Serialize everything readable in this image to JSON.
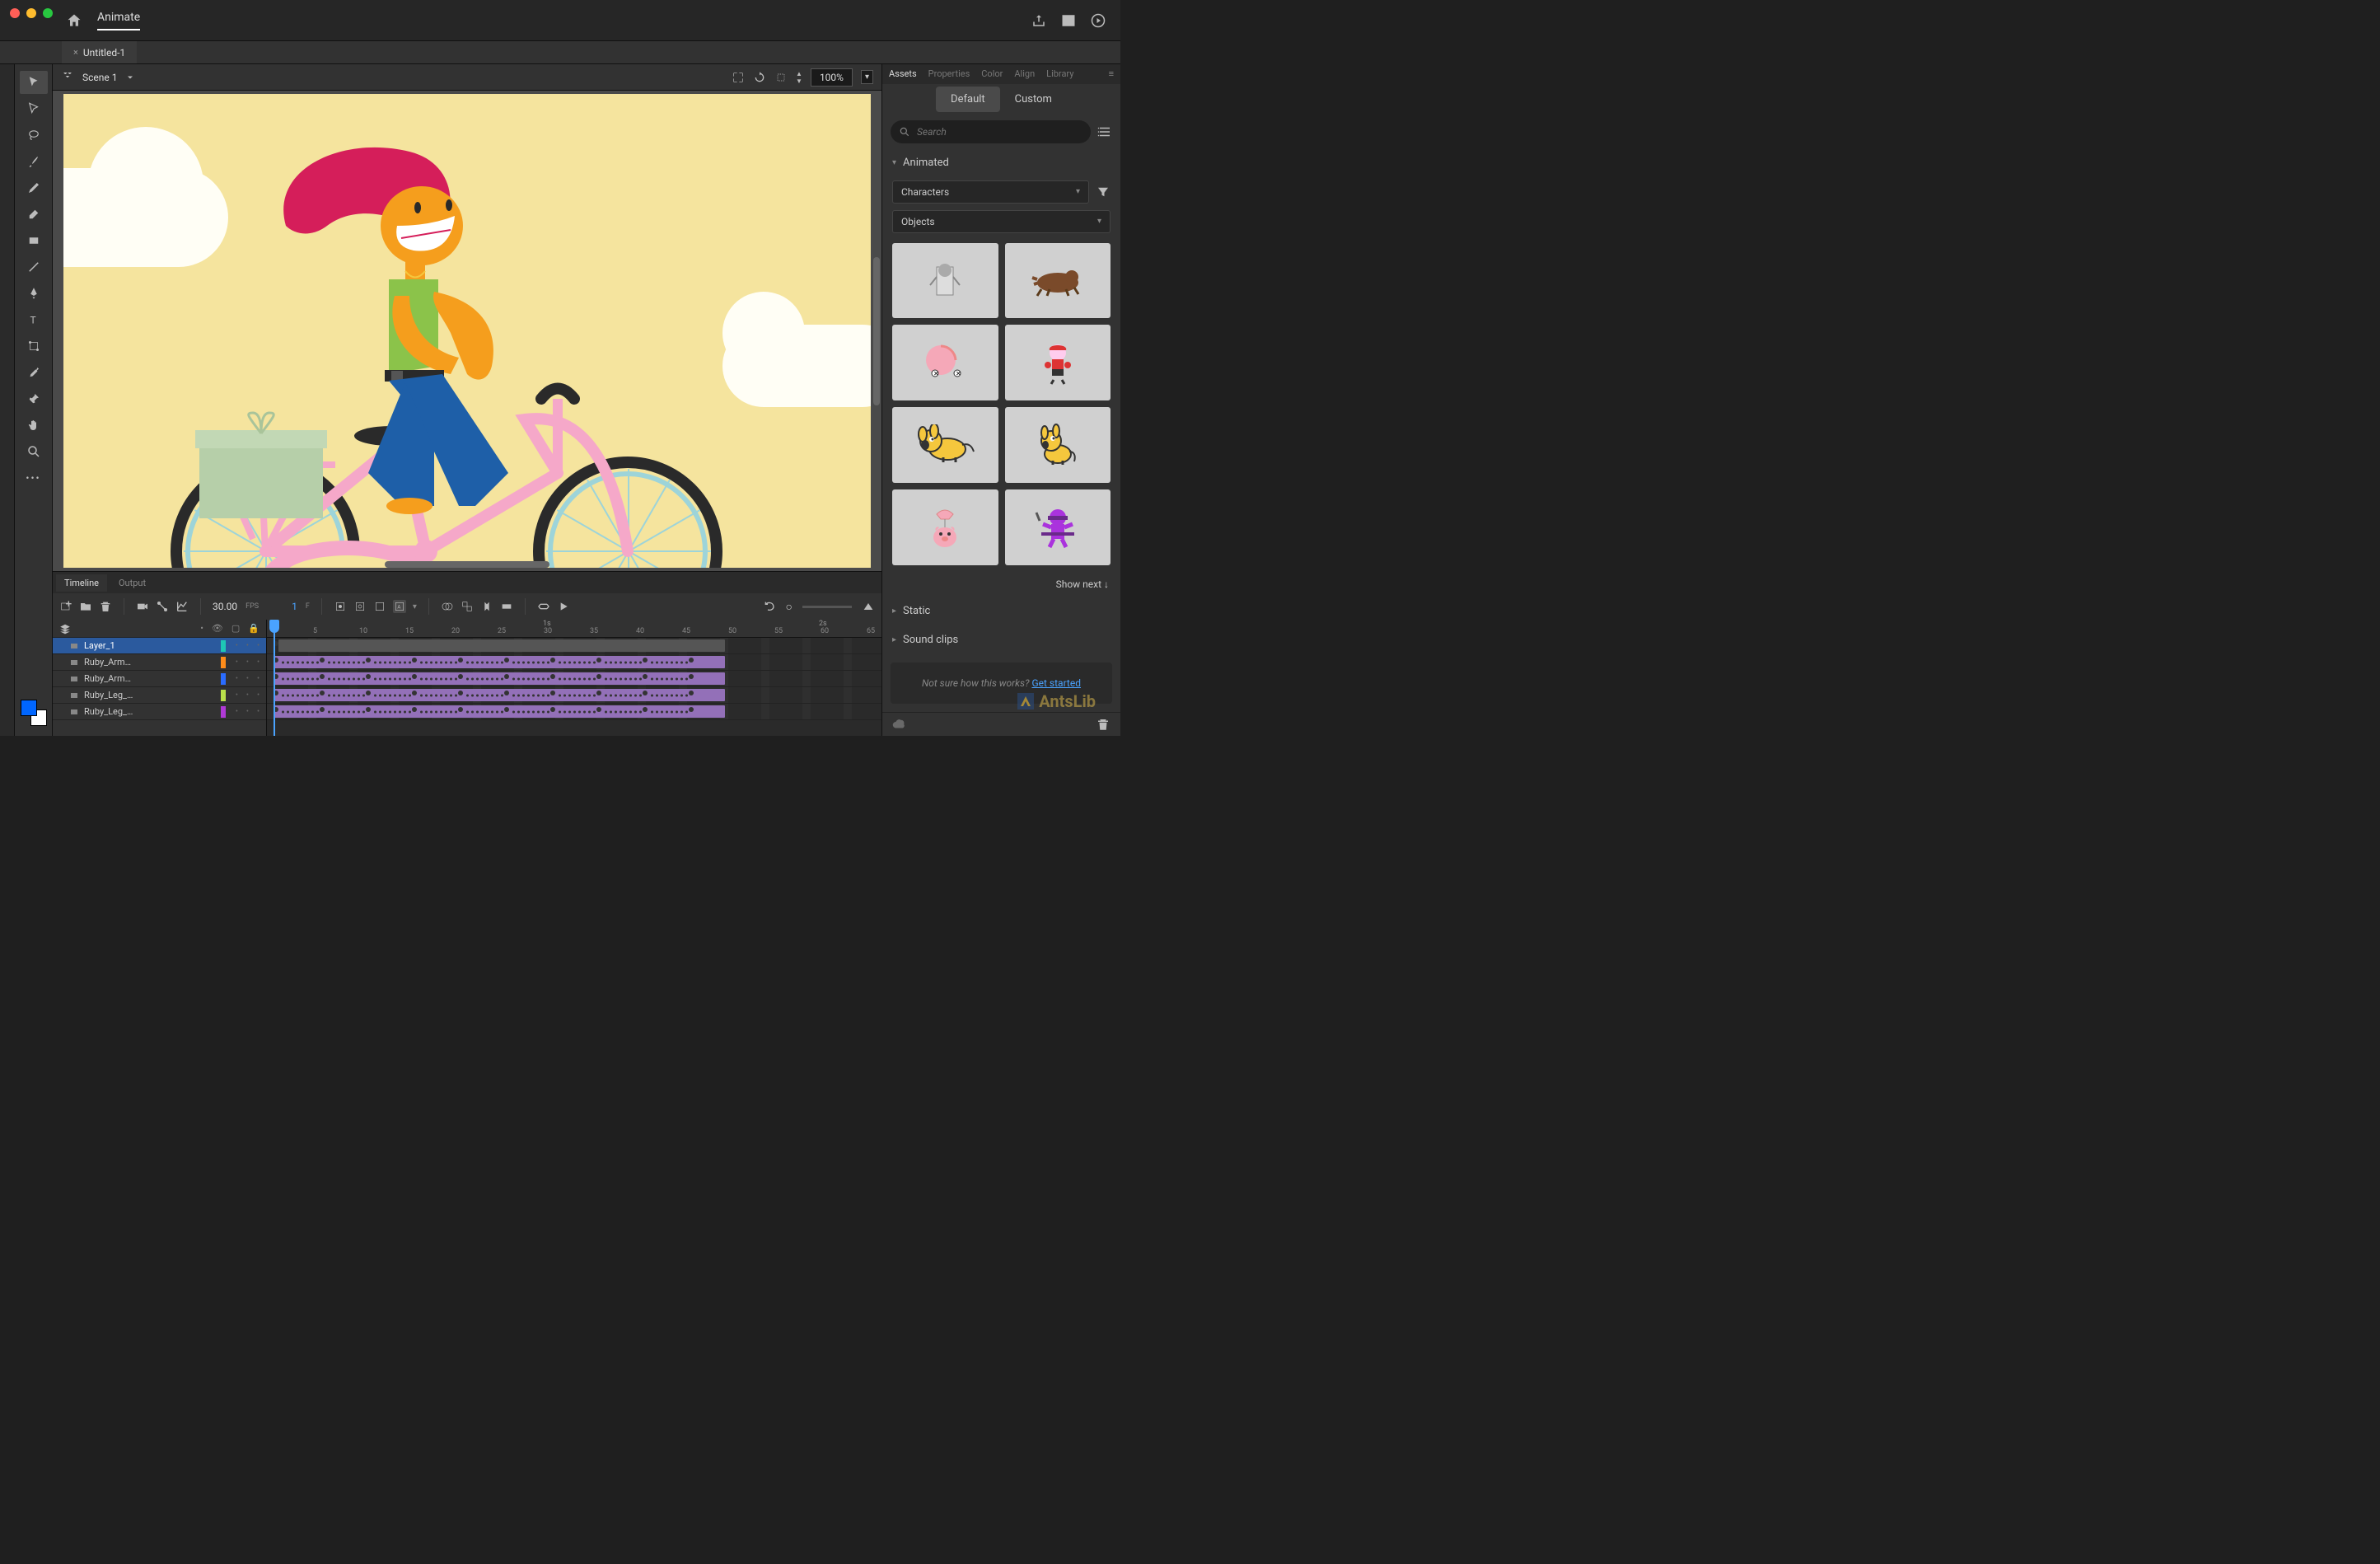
{
  "app": {
    "name": "Animate"
  },
  "document": {
    "tab": "Untitled-1"
  },
  "scene": {
    "name": "Scene 1",
    "zoom": "100%"
  },
  "timeline": {
    "tabs": [
      "Timeline",
      "Output"
    ],
    "fps_value": "30.00",
    "fps_label": "FPS",
    "frame_value": "1",
    "frame_label": "F",
    "ruler_marks": [
      "1s",
      "2s"
    ],
    "ruler_ticks": [
      "5",
      "10",
      "15",
      "20",
      "25",
      "30",
      "35",
      "40",
      "45",
      "50",
      "55",
      "60",
      "65"
    ],
    "layers": [
      {
        "name": "Layer_1",
        "color": "#1ec7b5"
      },
      {
        "name": "Ruby_Arm…",
        "color": "#ff8c1a"
      },
      {
        "name": "Ruby_Arm…",
        "color": "#2a6cff"
      },
      {
        "name": "Ruby_Leg_…",
        "color": "#b8e04a"
      },
      {
        "name": "Ruby_Leg_…",
        "color": "#b03ad6"
      }
    ]
  },
  "assets": {
    "tabs": [
      "Assets",
      "Properties",
      "Color",
      "Align",
      "Library"
    ],
    "subtabs": [
      "Default",
      "Custom"
    ],
    "search_placeholder": "Search",
    "sections": {
      "animated": "Animated",
      "static": "Static",
      "sound": "Sound clips"
    },
    "dropdown_characters": "Characters",
    "dropdown_objects": "Objects",
    "show_next": "Show next ↓",
    "help_text": "Not sure how this works? ",
    "help_link": "Get started"
  },
  "tools": [
    "selection",
    "subselect",
    "lasso",
    "brush",
    "pencil",
    "eraser",
    "rect",
    "line",
    "pen",
    "text",
    "transform",
    "eyedrop",
    "pin",
    "hand",
    "zoom",
    "more"
  ],
  "watermark": "AntsLib"
}
